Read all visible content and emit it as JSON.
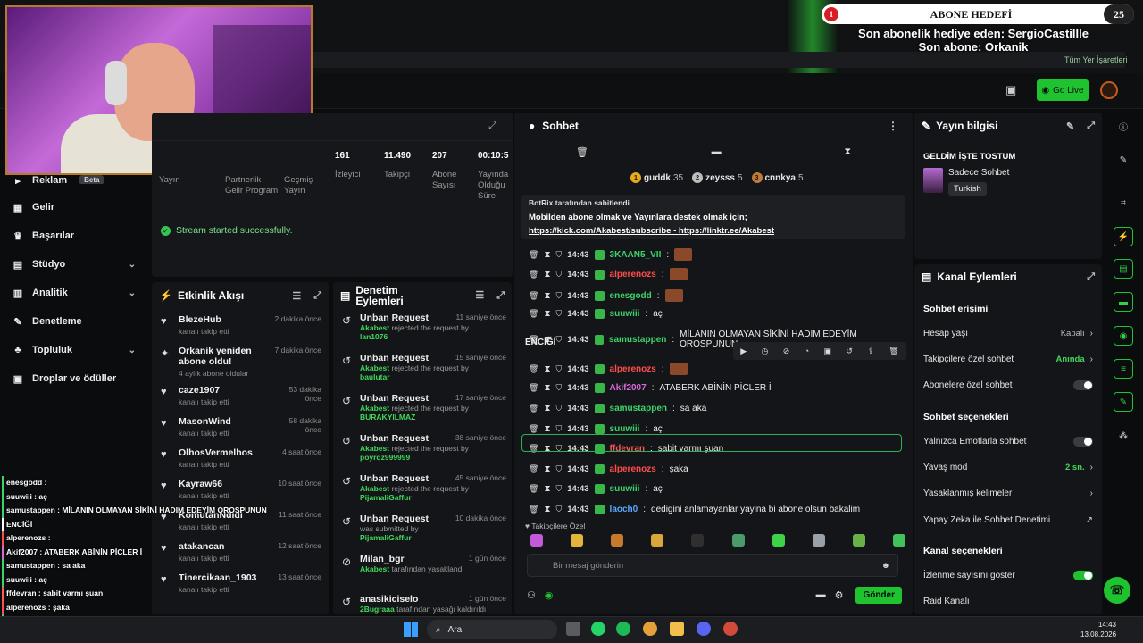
{
  "browser": {
    "bookmarks_label": "Tüm Yer İşaretleri"
  },
  "appbar": {
    "golive_label": "Go Live"
  },
  "overlay": {
    "goal_current": "1",
    "goal_title": "ABONE HEDEFİ",
    "goal_target": "25",
    "last_gift": "Son abonelik hediye eden: SergioCastillle",
    "last_sub": "Son abone: Orkanik",
    "chat": [
      "enesgodd : ",
      "suuwiii : aç",
      "samustappen : MİLANIN OLMAYAN SİKİNİ HADIM EDEYİM OROSPUNUN",
      "ENCİĞİ",
      "alperenozs : ",
      "Akif2007 : ATABERK ABİNİN PİCLER İ",
      "samustappen : sa aka",
      "suuwiii : aç",
      "ffdevran : sabit varmı şuan",
      "alperenozs : şaka",
      "suuwiii : aç",
      "laoch0 : dedigini anlamayanlar yayina bi abone olsun bakalim"
    ]
  },
  "nav": {
    "items": [
      {
        "label": "Reklam",
        "badge": "Beta",
        "icon": "megaphone-icon"
      },
      {
        "label": "Gelir",
        "icon": "wallet-icon"
      },
      {
        "label": "Başarılar",
        "icon": "trophy-icon"
      },
      {
        "label": "Stüdyo",
        "icon": "studio-icon"
      },
      {
        "label": "Analitik",
        "icon": "chart-icon"
      },
      {
        "label": "Denetleme",
        "icon": "wrench-icon"
      },
      {
        "label": "Topluluk",
        "icon": "community-icon"
      },
      {
        "label": "Droplar ve ödüller",
        "icon": "gift-icon"
      }
    ]
  },
  "stats": {
    "partial_labels": [
      "Yayın",
      "Partnerlik Gelir Programı",
      "Geçmiş Yayın"
    ],
    "items": [
      {
        "value": "161",
        "label": "İzleyici"
      },
      {
        "value": "11.490",
        "label": "Takipçi"
      },
      {
        "value": "207",
        "label": "Abone Sayısı"
      },
      {
        "value": "00:10:5",
        "label": "Yayında Olduğu Süre"
      }
    ],
    "status": "Stream started successfully."
  },
  "activity": {
    "title": "Etkinlik Akışı",
    "rows": [
      {
        "name": "BlezeHub",
        "sub": "kanalı takip etti",
        "time": "2 dakika önce"
      },
      {
        "name": "Orkanik yeniden abone oldu!",
        "sub": "4 aylık abone oldular",
        "time": "7 dakika önce"
      },
      {
        "name": "caze1907",
        "sub": "kanalı takip etti",
        "time": "53 dakika önce"
      },
      {
        "name": "MasonWind",
        "sub": "kanalı takip etti",
        "time": "58 dakika önce"
      },
      {
        "name": "OlhosVermelhos",
        "sub": "kanalı takip etti",
        "time": "4 saat önce"
      },
      {
        "name": "Kayraw66",
        "sub": "kanalı takip etti",
        "time": "10 saat önce"
      },
      {
        "name": "KomutanNdidi",
        "sub": "kanalı takip etti",
        "time": "11 saat önce"
      },
      {
        "name": "atakancan",
        "sub": "kanalı takip etti",
        "time": "12 saat önce"
      },
      {
        "name": "Tinercikaan_1903",
        "sub": "kanalı takip etti",
        "time": "13 saat önce"
      }
    ]
  },
  "moderation": {
    "title": "Denetim Eylemleri",
    "rows": [
      {
        "name": "Unban Request",
        "who": "Akabest",
        "txt": "rejected the request by",
        "target": "lan1076",
        "time": "11 saniye önce"
      },
      {
        "name": "Unban Request",
        "who": "Akabest",
        "txt": "rejected the request by",
        "target": "baulutar",
        "time": "15 saniye önce"
      },
      {
        "name": "Unban Request",
        "who": "Akabest",
        "txt": "rejected the request by",
        "target": "BURAKYILMAZ",
        "time": "17 saniye önce"
      },
      {
        "name": "Unban Request",
        "who": "Akabest",
        "txt": "rejected the request by",
        "target": "poyrqz999999",
        "time": "38 saniye önce"
      },
      {
        "name": "Unban Request",
        "who": "Akabest",
        "txt": "rejected the request by",
        "target": "PijamaliGaffur",
        "time": "45 saniye önce"
      },
      {
        "name": "Unban Request",
        "who": "",
        "txt": "was submitted by",
        "target": "PijamaliGaffur",
        "time": "10 dakika önce"
      },
      {
        "name": "Milan_bgr",
        "who": "Akabest",
        "txt": "tarafından yasaklandı",
        "target": "",
        "time": "1 gün önce"
      },
      {
        "name": "anasikiciselo",
        "who": "2Bugraaa",
        "txt": "tarafından yasağı kaldırıldı",
        "target": "",
        "time": "1 gün önce"
      }
    ]
  },
  "chat": {
    "title": "Sohbet",
    "top": [
      {
        "name": "guddk",
        "count": "35",
        "color": "#e8a91b"
      },
      {
        "name": "zeysss",
        "count": "5",
        "color": "#bdbdbd"
      },
      {
        "name": "cnnkya",
        "count": "5",
        "color": "#c27a3a"
      }
    ],
    "pinned_by": "BotRix tarafından sabitlendi",
    "pinned_msg": "Mobilden abone olmak ve Yayınlara destek olmak için;",
    "pinned_link1": "https://kick.com/Akabest/subscribe",
    "pinned_sep": " - ",
    "pinned_link2": "https://linktr.ee/Akabest",
    "messages": [
      {
        "time": "14:43",
        "user": "3KAAN5_VII",
        "color": "#3ed36a",
        "text": ""
      },
      {
        "time": "14:43",
        "user": "alperenozs",
        "color": "#ff4d4d",
        "text": ""
      },
      {
        "time": "14:43",
        "user": "enesgodd",
        "color": "#3ed36a",
        "text": ""
      },
      {
        "time": "14:43",
        "user": "suuwiii",
        "color": "#3ed36a",
        "text": "aç"
      },
      {
        "time": "14:43",
        "user": "samustappen",
        "color": "#3ed36a",
        "text": "MİLANIN OLMAYAN SİKİNİ HADIM EDEYİM OROSPUNUN"
      },
      {
        "time": "14:43",
        "user": "alperenozs",
        "color": "#ff4d4d",
        "text": ""
      },
      {
        "time": "14:43",
        "user": "Akif2007",
        "color": "#d86ad8",
        "text": "ATABERK ABİNİN PİCLER İ"
      },
      {
        "time": "14:43",
        "user": "samustappen",
        "color": "#3ed36a",
        "text": "sa aka"
      },
      {
        "time": "14:43",
        "user": "suuwiii",
        "color": "#3ed36a",
        "text": "aç"
      },
      {
        "time": "14:43",
        "user": "ffdevran",
        "color": "#ff5a5a",
        "text": "sabit varmı şuan"
      },
      {
        "time": "14:43",
        "user": "alperenozs",
        "color": "#ff4d4d",
        "text": "şaka"
      },
      {
        "time": "14:43",
        "user": "suuwiii",
        "color": "#3ed36a",
        "text": "aç"
      },
      {
        "time": "14:43",
        "user": "laoch0",
        "color": "#5aa8ff",
        "text": "dedigini anlamayanlar yayina bi abone olsun bakalim"
      }
    ],
    "continuation": "ENCİĞİ",
    "followers_only": "Takipçilere Özel",
    "input_placeholder": "Bir mesaj gönderin",
    "send_label": "Gönder"
  },
  "info": {
    "title": "Yayın bilgisi",
    "stream_title": "GELDİM İŞTE TOSTUM",
    "category": "Sadece Sohbet",
    "language": "Turkish"
  },
  "actions": {
    "title": "Kanal Eylemleri",
    "chat_access": "Sohbet erişimi",
    "account_age": {
      "label": "Hesap yaşı",
      "value": "Kapalı"
    },
    "followers_chat": {
      "label": "Takipçilere özel sohbet",
      "value": "Anında"
    },
    "subs_chat": {
      "label": "Abonelere özel sohbet"
    },
    "chat_options": "Sohbet seçenekleri",
    "emote_only": {
      "label": "Yalnızca Emotlarla sohbet"
    },
    "slow_mode": {
      "label": "Yavaş mod",
      "value": "2 sn."
    },
    "banned_words": {
      "label": "Yasaklanmış kelimeler"
    },
    "ai_mod": {
      "label": "Yapay Zeka ile Sohbet Denetimi"
    },
    "channel_options": "Kanal seçenekleri",
    "show_viewers": {
      "label": "İzlenme sayısını göster"
    },
    "raid": {
      "label": "Raid Kanalı"
    }
  },
  "taskbar": {
    "search": "Ara",
    "time": "14:43",
    "date": "13.08.2026"
  }
}
